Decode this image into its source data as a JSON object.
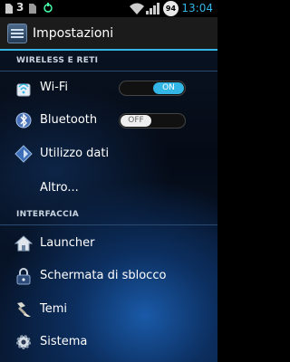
{
  "statusbar": {
    "carrier_icon": "3",
    "battery_level": "94",
    "time": "13:04"
  },
  "actionbar": {
    "title": "Impostazioni"
  },
  "sections": {
    "wireless": "WIRELESS E RETI",
    "interface": "INTERFACCIA"
  },
  "items": {
    "wifi": {
      "label": "Wi-Fi",
      "icon": "wifi-icon",
      "toggle": "ON"
    },
    "bluetooth": {
      "label": "Bluetooth",
      "icon": "bluetooth-icon",
      "toggle": "OFF"
    },
    "data_usage": {
      "label": "Utilizzo dati",
      "icon": "data-usage-icon"
    },
    "more": {
      "label": "Altro..."
    },
    "launcher": {
      "label": "Launcher",
      "icon": "home-icon"
    },
    "lockscreen": {
      "label": "Schermata di sblocco",
      "icon": "lock-icon"
    },
    "themes": {
      "label": "Temi",
      "icon": "brush-icon"
    },
    "system": {
      "label": "Sistema",
      "icon": "gear-icon"
    }
  },
  "colors": {
    "accent": "#33b5e5",
    "background": "#0a1424"
  }
}
